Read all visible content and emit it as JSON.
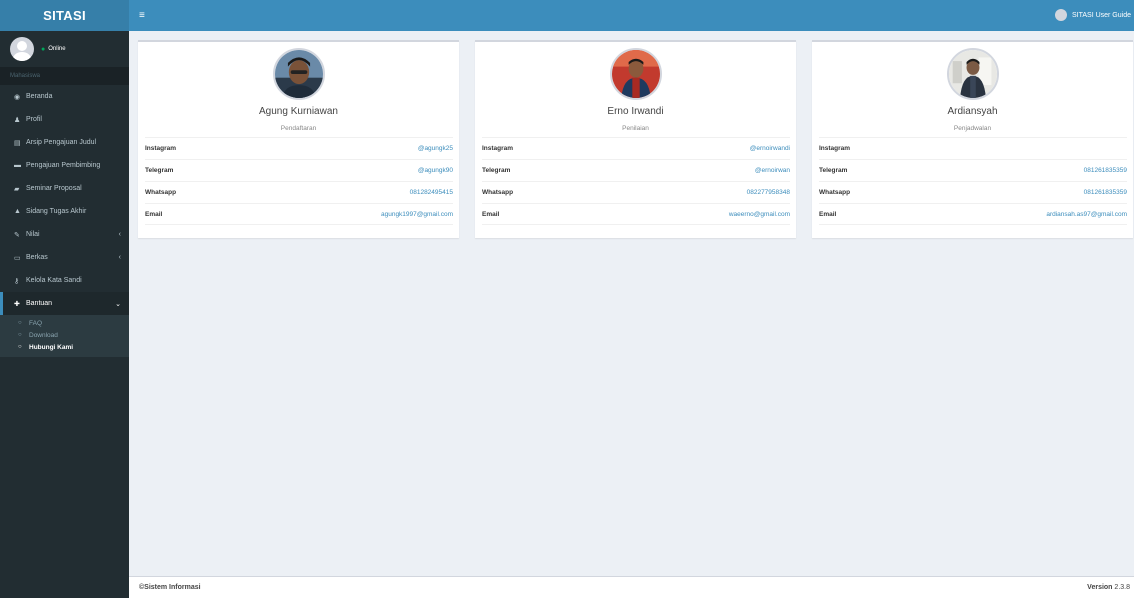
{
  "app": {
    "logo": "SITASI",
    "user_status": "Online",
    "menu_header": "Mahasiswa",
    "guide_label": "SITASI User Guide"
  },
  "sidebar": {
    "items": [
      {
        "label": "Beranda",
        "icon": "dashboard-icon"
      },
      {
        "label": "Profil",
        "icon": "user-icon"
      },
      {
        "label": "Arsip Pengajuan Judul",
        "icon": "file-icon"
      },
      {
        "label": "Pengajuan Pembimbing",
        "icon": "folder-icon"
      },
      {
        "label": "Seminar Proposal",
        "icon": "book-icon"
      },
      {
        "label": "Sidang Tugas Akhir",
        "icon": "graduation-cap-icon"
      },
      {
        "label": "Nilai",
        "icon": "edit-icon"
      },
      {
        "label": "Berkas",
        "icon": "folder-open-icon"
      },
      {
        "label": "Kelola Kata Sandi",
        "icon": "key-icon"
      },
      {
        "label": "Bantuan",
        "icon": "plus-icon"
      }
    ],
    "submenu": [
      {
        "label": "FAQ"
      },
      {
        "label": "Download"
      },
      {
        "label": "Hubungi Kami"
      }
    ]
  },
  "contacts": [
    {
      "name": "Agung Kurniawan",
      "role": "Pendaftaran",
      "instagram": "@agungk25",
      "telegram": "@agungk90",
      "whatsapp": "081282495415",
      "email": "agungk1997@gmail.com"
    },
    {
      "name": "Erno Irwandi",
      "role": "Penilaian",
      "instagram": "@ernoirwandi",
      "telegram": "@ernoirwan",
      "whatsapp": "082277958348",
      "email": "waeerno@gmail.com"
    },
    {
      "name": "Ardiansyah",
      "role": "Penjadwalan",
      "instagram": "",
      "telegram": "081261835359",
      "whatsapp": "081261835359",
      "email": "ardiansah.as97@gmail.com"
    }
  ],
  "labels": {
    "instagram": "Instagram",
    "telegram": "Telegram",
    "whatsapp": "Whatsapp",
    "email": "Email"
  },
  "footer": {
    "copyright": "©Sistem Informasi",
    "version_label": "Version",
    "version": "2.3.8"
  },
  "colors": {
    "header": "#3c8dbc",
    "logo": "#367fa9",
    "sidebar": "#222d32",
    "background": "#ecf0f5"
  }
}
